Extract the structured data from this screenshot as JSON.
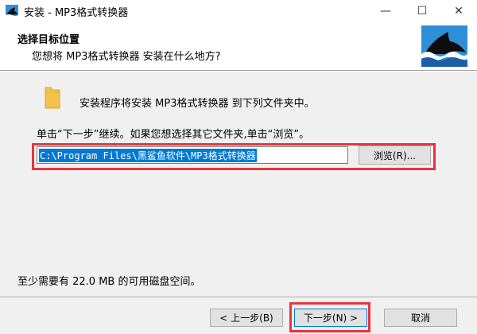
{
  "window": {
    "title": "安装 - MP3格式转换器",
    "controls": {
      "minimize": "—",
      "maximize": "☐",
      "close": "✕"
    }
  },
  "header": {
    "title": "选择目标位置",
    "subtitle": "您想将 MP3格式转换器 安装在什么地方?"
  },
  "body": {
    "info": "安装程序将安装 MP3格式转换器 到下列文件夹中。",
    "instruction": "单击“下一步”继续。如果您想选择其它文件夹,单击“浏览”。",
    "path_value": "C:\\Program Files\\黑鲨鱼软件\\MP3格式转换器",
    "browse_label": "浏览(R)...",
    "space_required": "至少需要有 22.0 MB 的可用磁盘空间。"
  },
  "footer": {
    "back_label": "< 上一步(B)",
    "next_label": "下一步(N) >",
    "cancel_label": "取消"
  },
  "colors": {
    "highlight": "#e8353d",
    "selection": "#0078d7",
    "logo_bg": "#2f8fd6"
  },
  "icons": {
    "app": "shark-logo-icon",
    "folder": "folder-icon"
  }
}
